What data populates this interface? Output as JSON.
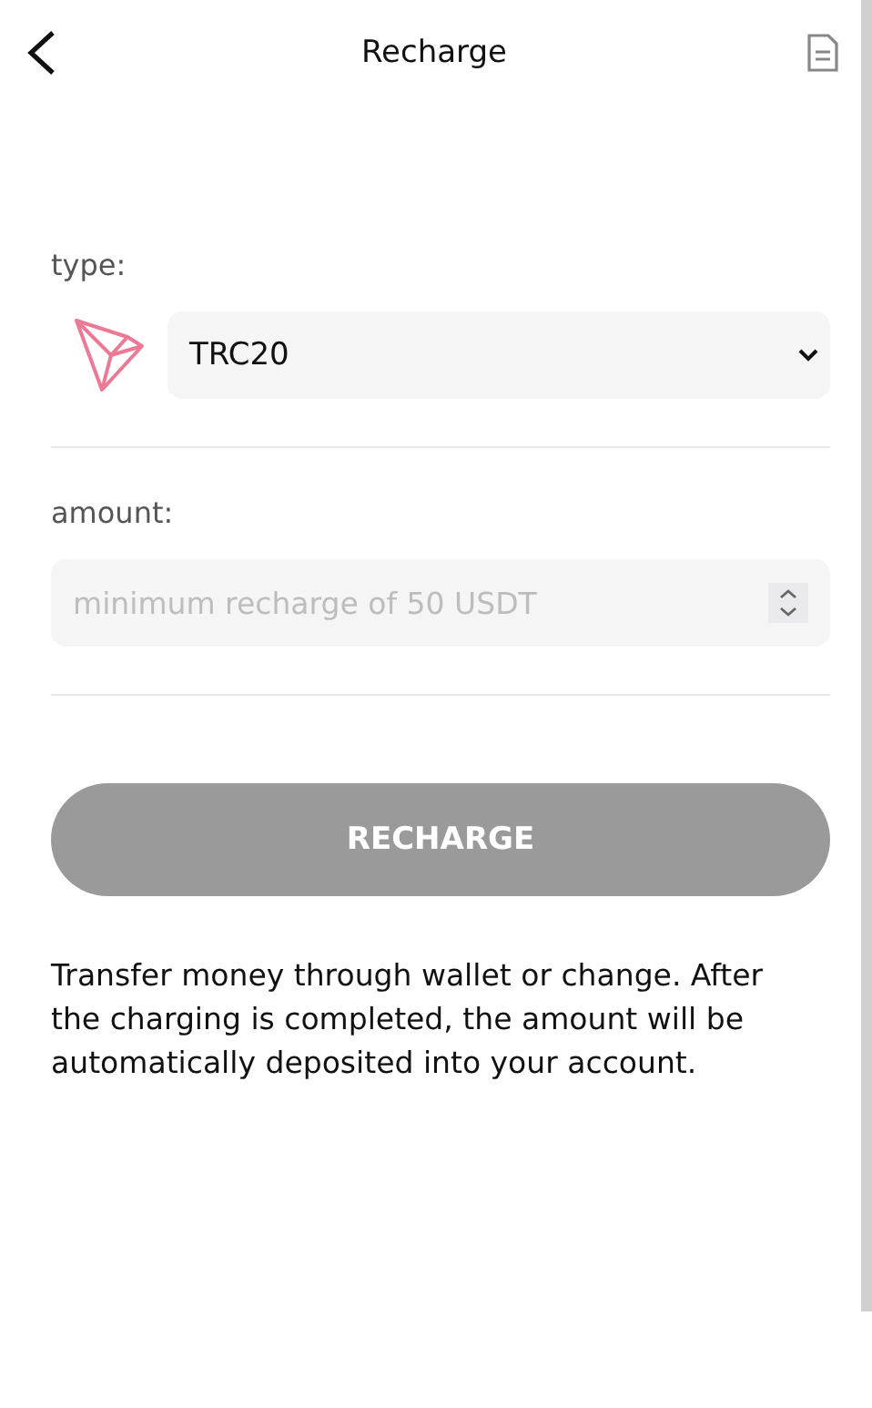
{
  "header": {
    "title": "Recharge"
  },
  "type_field": {
    "label": "type:",
    "value": "TRC20"
  },
  "amount_field": {
    "label": "amount:",
    "placeholder": "minimum recharge of 50 USDT"
  },
  "recharge_button": {
    "label": "RECHARGE",
    "disabled": true
  },
  "note": "Transfer money through wallet or change. After the charging is completed, the amount will be automatically deposited into your account."
}
